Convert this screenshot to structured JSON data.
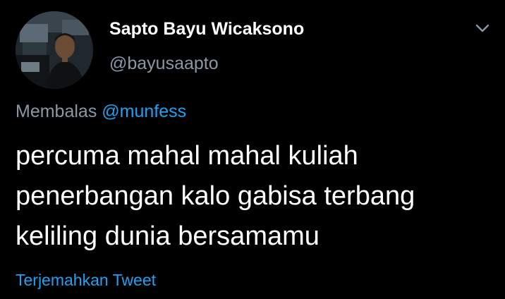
{
  "user": {
    "display_name": "Sapto Bayu Wicaksono",
    "handle": "@bayusaapto"
  },
  "reply": {
    "prefix": "Membalas",
    "mention": "@munfess"
  },
  "tweet": {
    "lines": [
      "percuma mahal mahal kuliah",
      "penerbangan kalo gabisa terbang",
      "keliling dunia bersamamu"
    ]
  },
  "actions": {
    "translate_label": "Terjemahkan Tweet"
  },
  "icons": {
    "menu": "chevron-down-icon"
  },
  "colors": {
    "background": "#000000",
    "text_primary": "#ffffff",
    "text_secondary": "#8899a6",
    "accent": "#1da1f2"
  }
}
